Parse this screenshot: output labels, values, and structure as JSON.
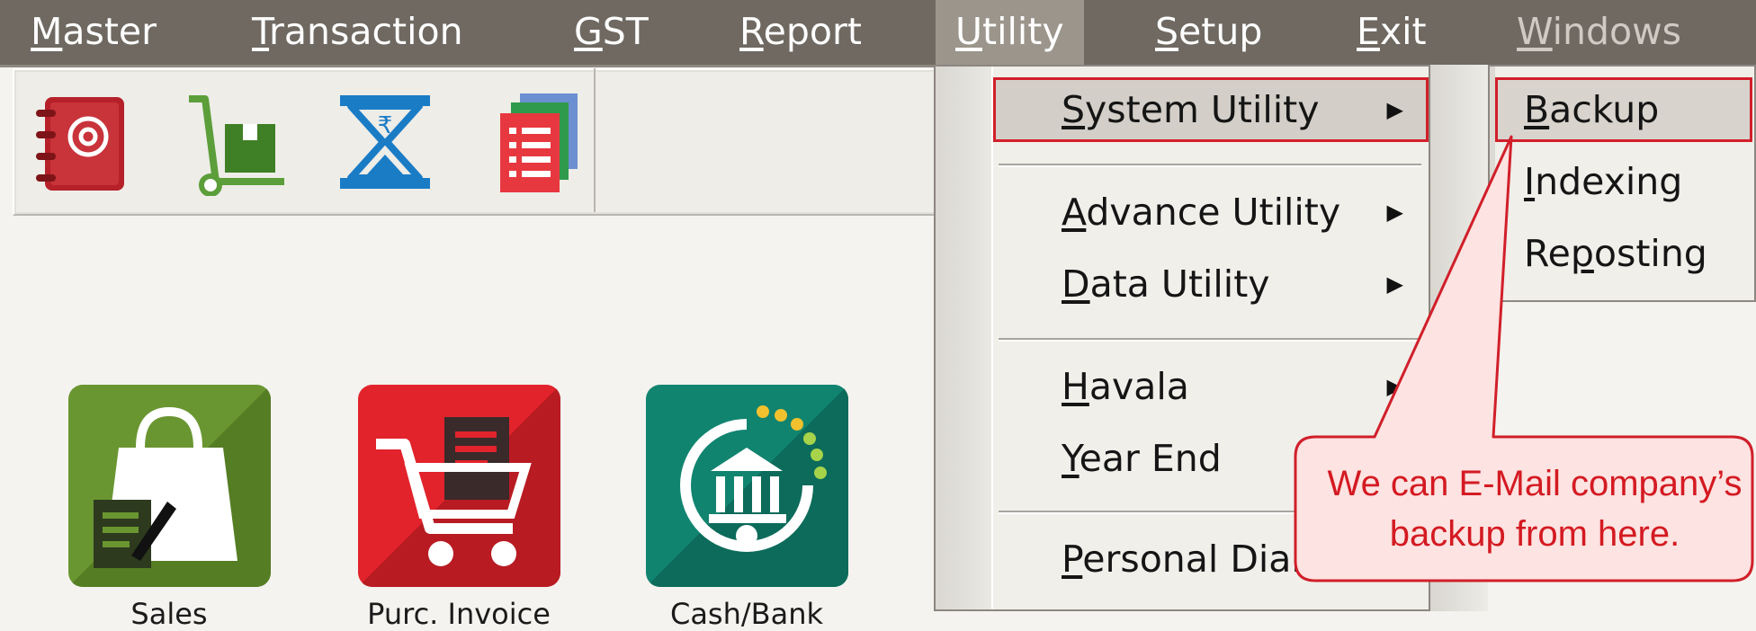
{
  "menubar": {
    "items": [
      {
        "pre": "",
        "u": "M",
        "post": "aster"
      },
      {
        "pre": "",
        "u": "T",
        "post": "ransaction"
      },
      {
        "pre": "",
        "u": "G",
        "post": "ST"
      },
      {
        "pre": "",
        "u": "R",
        "post": "eport"
      },
      {
        "pre": "",
        "u": "U",
        "post": "tility"
      },
      {
        "pre": "",
        "u": "S",
        "post": "etup"
      },
      {
        "pre": "",
        "u": "E",
        "post": "xit"
      },
      {
        "pre": "",
        "u": "W",
        "post": "indows"
      }
    ]
  },
  "toolbar": {
    "icons": [
      "address-book-icon",
      "trolley-box-icon",
      "rupee-hourglass-icon",
      "documents-stack-icon"
    ]
  },
  "tiles": [
    {
      "label": "Sales",
      "icon": "shopping-bag-icon",
      "color": "#5f8a2c"
    },
    {
      "label": "Purc. Invoice",
      "icon": "cart-invoice-icon",
      "color": "#d3212a"
    },
    {
      "label": "Cash/Bank",
      "icon": "bank-icon",
      "color": "#0f7d6a"
    }
  ],
  "dropdown": {
    "system_utility": {
      "u": "S",
      "post": "ystem Utility"
    },
    "advance_utility": {
      "u": "A",
      "post": "dvance Utility"
    },
    "data_utility": {
      "u": "D",
      "post": "ata Utility"
    },
    "havala": {
      "u": "H",
      "post": "avala"
    },
    "year_end": {
      "u": "Y",
      "post": "ear End"
    },
    "personal_diary": {
      "u": "P",
      "post": "ersonal Diary"
    }
  },
  "submenu": {
    "backup": {
      "pre": "",
      "u": "B",
      "post": "ackup"
    },
    "indexing": {
      "pre": "",
      "u": "I",
      "post": "ndexing"
    },
    "reposting": {
      "pre": "Re",
      "u": "p",
      "post": "osting"
    }
  },
  "callout": {
    "line1": "We can E-Mail company’s",
    "line2": "backup from here."
  },
  "colors": {
    "menubar": "#6f6962",
    "highlight_outline": "#d11f2a",
    "callout_text": "#d41a22",
    "callout_fill": "#fde3e1"
  }
}
